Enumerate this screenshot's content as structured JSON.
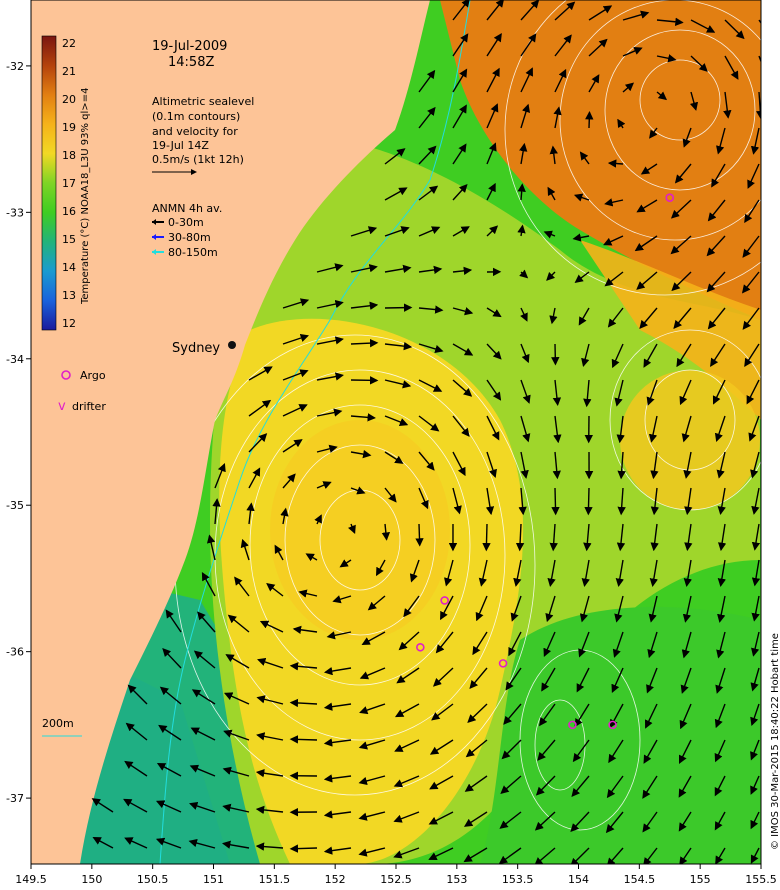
{
  "header": {
    "date": "19-Jul-2009",
    "time": "14:58Z"
  },
  "altimetry_note": {
    "line1": "Altimetric sealevel",
    "line2": "(0.1m contours)",
    "line3": "and velocity for",
    "line4": "19-Jul 14Z",
    "scale_label": "0.5m/s (1kt 12h)"
  },
  "anmn": {
    "title": "ANMN 4h av.",
    "items": [
      {
        "label": "0-30m",
        "color": "#000000"
      },
      {
        "label": "30-80m",
        "color": "#1a1aff"
      },
      {
        "label": "80-150m",
        "color": "#22dddd"
      }
    ]
  },
  "colorbar": {
    "label": "Temperature (°C) NOAA18_L3U 93% ql>=4",
    "ticks": [
      "22",
      "21",
      "20",
      "19",
      "18",
      "17",
      "16",
      "15",
      "14",
      "13",
      "12"
    ],
    "colors": [
      "#7a1510",
      "#b4420c",
      "#e27f12",
      "#f5b21a",
      "#f2d824",
      "#b8dc2a",
      "#3fcd22",
      "#22b37a",
      "#1a9bd0",
      "#1a62dc",
      "#1a1a9c"
    ]
  },
  "place_label": "Sydney",
  "legend": {
    "argo_label": "Argo",
    "drifter_label": "drifter",
    "argo_color": "#e020c8"
  },
  "isobath_label": "200m",
  "credit": "© IMOS 30-Mar-2015 18:40:22 Hobart time",
  "chart_data": {
    "type": "map",
    "x_ticks": [
      "149.5",
      "150",
      "150.5",
      "151",
      "151.5",
      "152",
      "152.5",
      "153",
      "153.5",
      "154",
      "154.5",
      "155",
      "155.5"
    ],
    "y_ticks": [
      "-32",
      "-33",
      "-34",
      "-35",
      "-36",
      "-37"
    ],
    "xlim": [
      149.5,
      155.5
    ],
    "ylim": [
      -37.45,
      -31.55
    ],
    "argo_floats": [
      {
        "lon": 154.75,
        "lat": -32.9
      },
      {
        "lon": 152.9,
        "lat": -35.65
      },
      {
        "lon": 152.7,
        "lat": -35.97
      },
      {
        "lon": 153.38,
        "lat": -36.08
      },
      {
        "lon": 153.95,
        "lat": -36.5
      },
      {
        "lon": 154.28,
        "lat": -36.5
      }
    ],
    "eddies": [
      {
        "lon": 152.1,
        "lat": -35.2,
        "kind": "warm-core"
      },
      {
        "lon": 154.75,
        "lat": -32.15,
        "kind": "warm-core"
      }
    ]
  }
}
